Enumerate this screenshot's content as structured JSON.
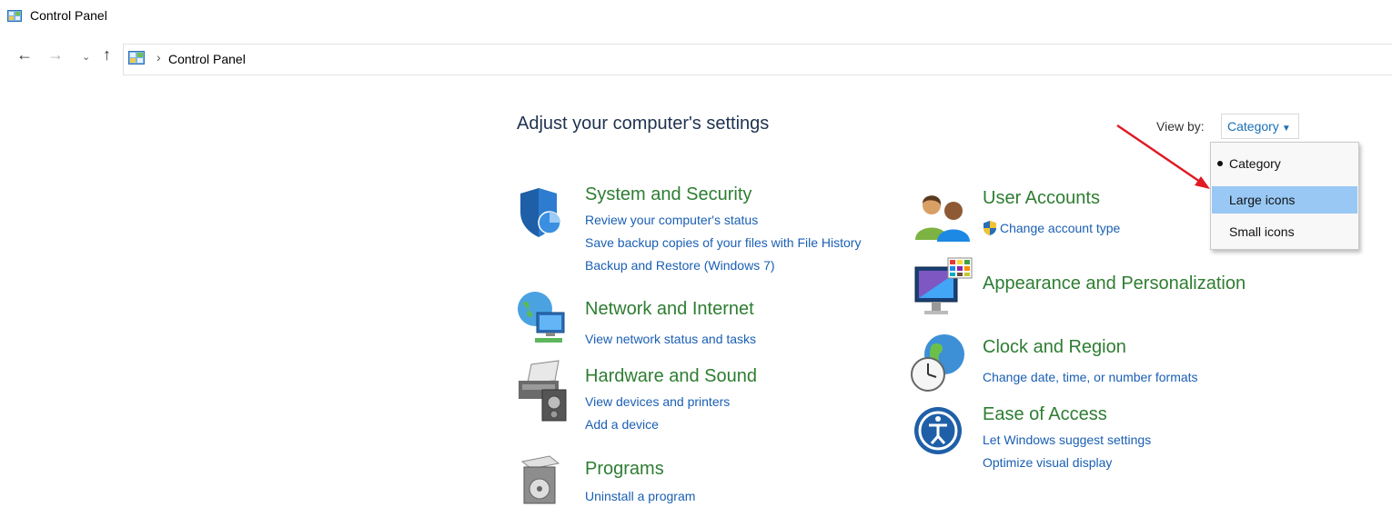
{
  "window": {
    "title": "Control Panel"
  },
  "address_bar": {
    "back": "←",
    "forward": "→",
    "recent": "⌄",
    "up": "↑",
    "separator": "›",
    "path": "Control Panel"
  },
  "heading": "Adjust your computer's settings",
  "view_by": {
    "label": "View by:",
    "selected": "Category",
    "options": [
      "Category",
      "Large icons",
      "Small icons"
    ]
  },
  "categories": [
    {
      "title": "System and Security",
      "links": [
        "Review your computer's status",
        "Save backup copies of your files with File History",
        "Backup and Restore (Windows 7)"
      ]
    },
    {
      "title": "Network and Internet",
      "links": [
        "View network status and tasks"
      ]
    },
    {
      "title": "Hardware and Sound",
      "links": [
        "View devices and printers",
        "Add a device"
      ]
    },
    {
      "title": "Programs",
      "links": [
        "Uninstall a program"
      ]
    },
    {
      "title": "User Accounts",
      "links": [
        "Change account type"
      ]
    },
    {
      "title": "Appearance and Personalization",
      "links": []
    },
    {
      "title": "Clock and Region",
      "links": [
        "Change date, time, or number formats"
      ]
    },
    {
      "title": "Ease of Access",
      "links": [
        "Let Windows suggest settings",
        "Optimize visual display"
      ]
    }
  ],
  "colors": {
    "category_title": "#2e7d32",
    "link": "#1a5fb4",
    "highlight": "#99c8f5",
    "annotation_arrow": "#e01b24"
  }
}
